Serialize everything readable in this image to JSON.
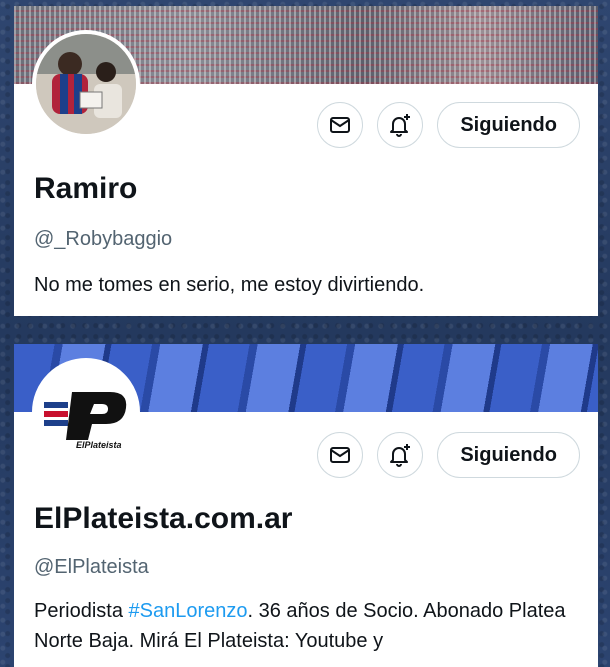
{
  "profiles": [
    {
      "name": "Ramiro",
      "handle": "@_Robybaggio",
      "bio": "No me tomes en serio, me estoy divirtiendo.",
      "follow_label": "Siguiendo",
      "icons": [
        "mail-icon",
        "bell-plus-icon"
      ]
    },
    {
      "name": "ElPlateista.com.ar",
      "handle": "@ElPlateista",
      "bio_pre": "Periodista ",
      "bio_hashtag": "#SanLorenzo",
      "bio_post": ". 36 años de Socio. Abonado Platea Norte Baja. Mirá El Plateista: Youtube y",
      "follow_label": "Siguiendo",
      "logo_text": "ElPlateista",
      "icons": [
        "mail-icon",
        "bell-plus-icon"
      ]
    }
  ],
  "colors": {
    "accent": "#1d9bf0",
    "text": "#0f1419",
    "muted": "#536471",
    "border": "#cfd9de"
  }
}
